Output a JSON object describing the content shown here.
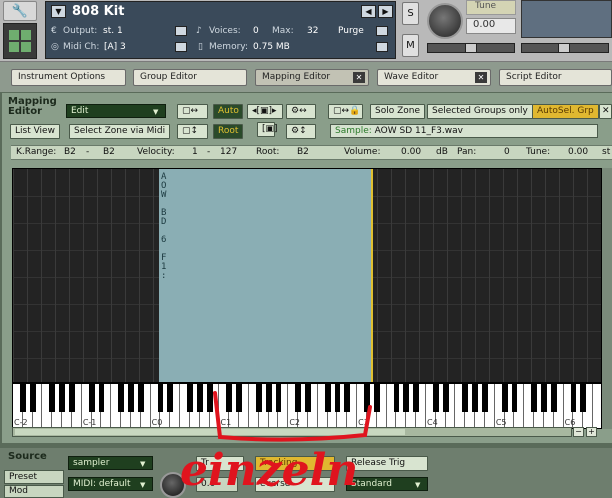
{
  "header": {
    "instrument_name": "808 Kit",
    "output_label": "Output:",
    "output_value": "st. 1",
    "midi_label": "Midi Ch:",
    "midi_value": "[A]  3",
    "voices_label": "Voices:",
    "voices_value": "0",
    "max_label": "Max:",
    "max_value": "32",
    "purge_label": "Purge",
    "memory_label": "Memory:",
    "memory_value": "0.75 MB",
    "solo_label": "S",
    "mute_label": "M",
    "tune_label": "Tune",
    "tune_value": "0.00"
  },
  "tabs": [
    {
      "label": "Instrument Options"
    },
    {
      "label": "Group Editor"
    },
    {
      "label": "Mapping Editor"
    },
    {
      "label": "Wave Editor"
    },
    {
      "label": "Script Editor"
    }
  ],
  "mapping": {
    "title_line1": "Mapping",
    "title_line2": "Editor",
    "edit_combo": "Edit",
    "list_view": "List View",
    "select_zone_midi": "Select Zone via Midi",
    "auto_label": "Auto",
    "root_label": "Root",
    "solo_zone": "Solo Zone",
    "selected_groups_only": "Selected Groups only",
    "autosel_grp": "AutoSel. Grp",
    "sample_label": "Sample:",
    "sample_value": "AOW SD 11_F3.wav",
    "zone_vertical_text": "AOW BD 6 F1:",
    "krange_label": "K.Range:",
    "krange_lo": "B2",
    "krange_dash": "-",
    "krange_hi": "B2",
    "velocity_label": "Velocity:",
    "vel_lo": "1",
    "vel_dash": "-",
    "vel_hi": "127",
    "root_field_label": "Root:",
    "root_value": "B2",
    "volume_label": "Volume:",
    "volume_value": "0.00",
    "volume_unit": "dB",
    "pan_label": "Pan:",
    "pan_value": "0",
    "tune_label": "Tune:",
    "tune_value": "0.00",
    "tune_unit_cut": "st",
    "octaves": [
      "C-2",
      "C-1",
      "C0",
      "C1",
      "C2",
      "C3",
      "C4",
      "C5",
      "C6"
    ]
  },
  "source": {
    "title": "Source",
    "preset": "Preset",
    "mod": "Mod",
    "sampler_combo": "sampler",
    "midi_combo": "MIDI: default",
    "tr_btn": "Tr",
    "tracking_btn": "Tracking",
    "release_trig": "Release Trig",
    "reverse_btn": "everse",
    "standard": "Standard",
    "knob_value": "0.0"
  },
  "annotation": {
    "text": "einzeln",
    "color": "#e0141e"
  }
}
